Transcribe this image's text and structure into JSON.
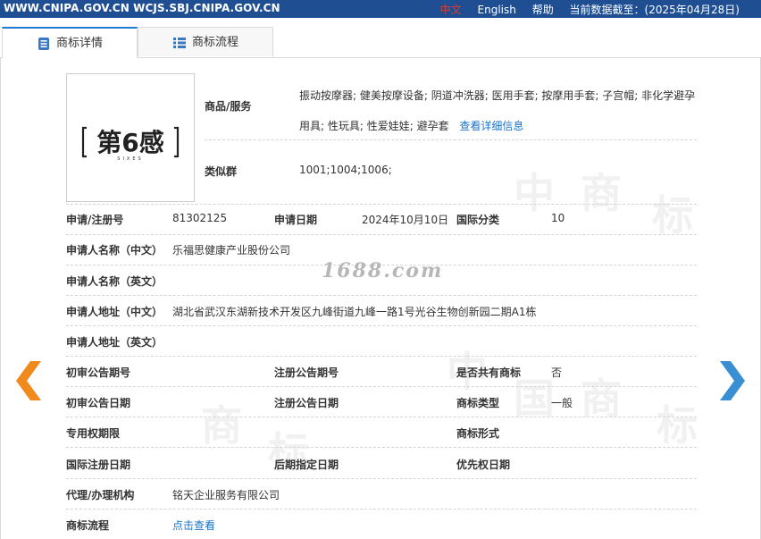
{
  "topbar": {
    "domains": "WWW.CNIPA.GOV.CN WCJS.SBJ.CNIPA.GOV.CN",
    "lang_cn": "中文",
    "lang_en": "English",
    "help": "帮助",
    "data_date": "当前数据截至：(2025年04月28日)"
  },
  "tabs": [
    {
      "label": "商标详情"
    },
    {
      "label": "商标流程"
    }
  ],
  "site_watermark": "1688.com",
  "watermark_chars": [
    "中",
    "国",
    "商",
    "标"
  ],
  "logo": {
    "text": "第6感",
    "subtext": "SIXES"
  },
  "goods": {
    "label": "商品/服务",
    "value": "振动按摩器; 健美按摩设备; 阴道冲洗器; 医用手套; 按摩用手套; 子宫帽; 非化学避孕用具; 性玩具; 性爱娃娃; 避孕套",
    "link": "查看详细信息"
  },
  "similar": {
    "label": "类似群",
    "value": "1001;1004;1006;"
  },
  "fields": {
    "reg_no_label": "申请/注册号",
    "reg_no": "81302125",
    "apply_date_label": "申请日期",
    "apply_date": "2024年10月10日",
    "intl_class_label": "国际分类",
    "intl_class": "10",
    "applicant_cn_label": "申请人名称（中文）",
    "applicant_cn": "乐福思健康产业股份公司",
    "applicant_en_label": "申请人名称（英文）",
    "address_cn_label": "申请人地址（中文）",
    "address_cn": "湖北省武汉东湖新技术开发区九峰街道九峰一路1号光谷生物创新园二期A1栋",
    "address_en_label": "申请人地址（英文）",
    "prelim_no_label": "初审公告期号",
    "reg_pub_no_label": "注册公告期号",
    "shared_label": "是否共有商标",
    "shared": "否",
    "prelim_date_label": "初审公告日期",
    "reg_pub_date_label": "注册公告日期",
    "tm_type_label": "商标类型",
    "tm_type": "一般",
    "exclusive_label": "专用权期限",
    "tm_form_label": "商标形式",
    "intl_reg_date_label": "国际注册日期",
    "later_date_label": "后期指定日期",
    "priority_date_label": "优先权日期",
    "agent_label": "代理/办理机构",
    "agent": "铭天企业服务有限公司",
    "flow_label": "商标流程",
    "flow_link": "点击查看"
  },
  "colors": {
    "topbar": "#1f4f92",
    "link": "#1a73c9",
    "arrow_left": "#f08a1c",
    "arrow_right": "#3a8fd3"
  }
}
